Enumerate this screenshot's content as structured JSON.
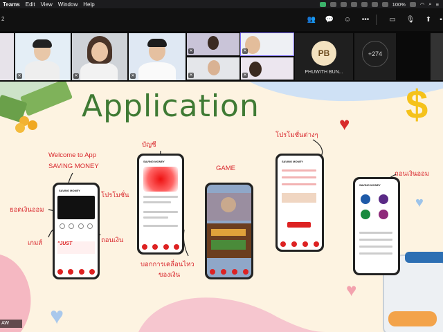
{
  "menubar": {
    "app_name": "Teams",
    "menus": [
      "Edit",
      "View",
      "Window",
      "Help"
    ],
    "battery": "100%",
    "icons": [
      "wifi-icon",
      "search-icon",
      "control-center-icon"
    ]
  },
  "toolbar": {
    "counter": "2"
  },
  "participants": {
    "pb_initials": "PB",
    "pb_name": "PHUWITH BUN...",
    "more_count": "+274"
  },
  "slide": {
    "title": "Application",
    "notes": {
      "welcome": "Welcome to App",
      "saving": "SAVING MONEY",
      "promotion": "โปรโมชั่น",
      "balance": "ยอดเงินออม",
      "game_th": "เกมส์",
      "withdraw": "ถอนเงิน",
      "account": "บัญชี",
      "game_en": "GAME",
      "promotions_misc": "โปรโมชั่นต่างๆ",
      "withdraw_savings": "ถอนเงินออม",
      "movement_1": "บอกการเคลื่อนไหว",
      "movement_2": "ของเงิน"
    },
    "phone_brand": "SAVING MONEY"
  },
  "bottom_label": "AW"
}
